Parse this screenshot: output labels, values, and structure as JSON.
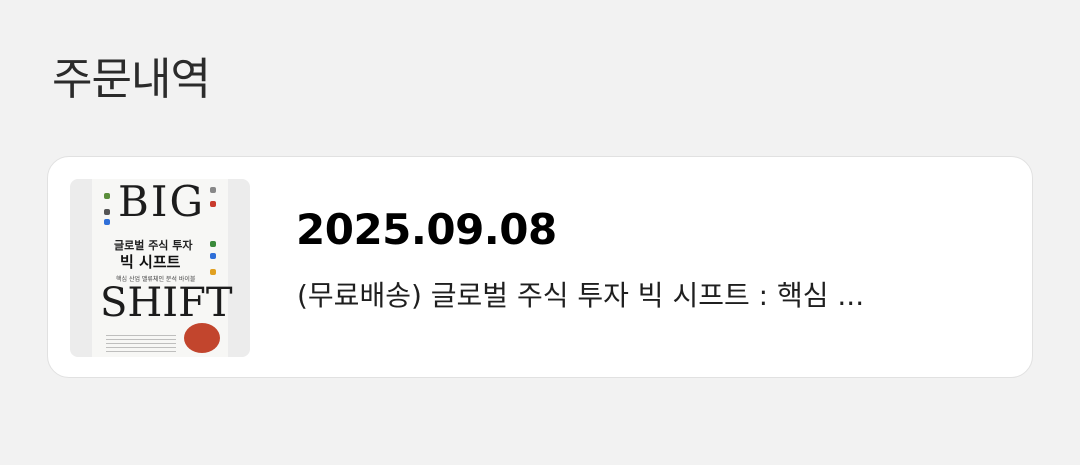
{
  "header": {
    "title": "주문내역"
  },
  "orders": [
    {
      "date": "2025.09.08",
      "product_name": "(무료배송) 글로벌 주식 투자 빅 시프트 : 핵심 ...",
      "cover": {
        "title_top": "BIG",
        "subtitle_line1": "글로벌 주식 투자",
        "subtitle_line2": "빅 시프트",
        "tagline": "핵심 산업 밸류체인 분석 바이블",
        "title_bottom": "SHIFT"
      }
    }
  ]
}
